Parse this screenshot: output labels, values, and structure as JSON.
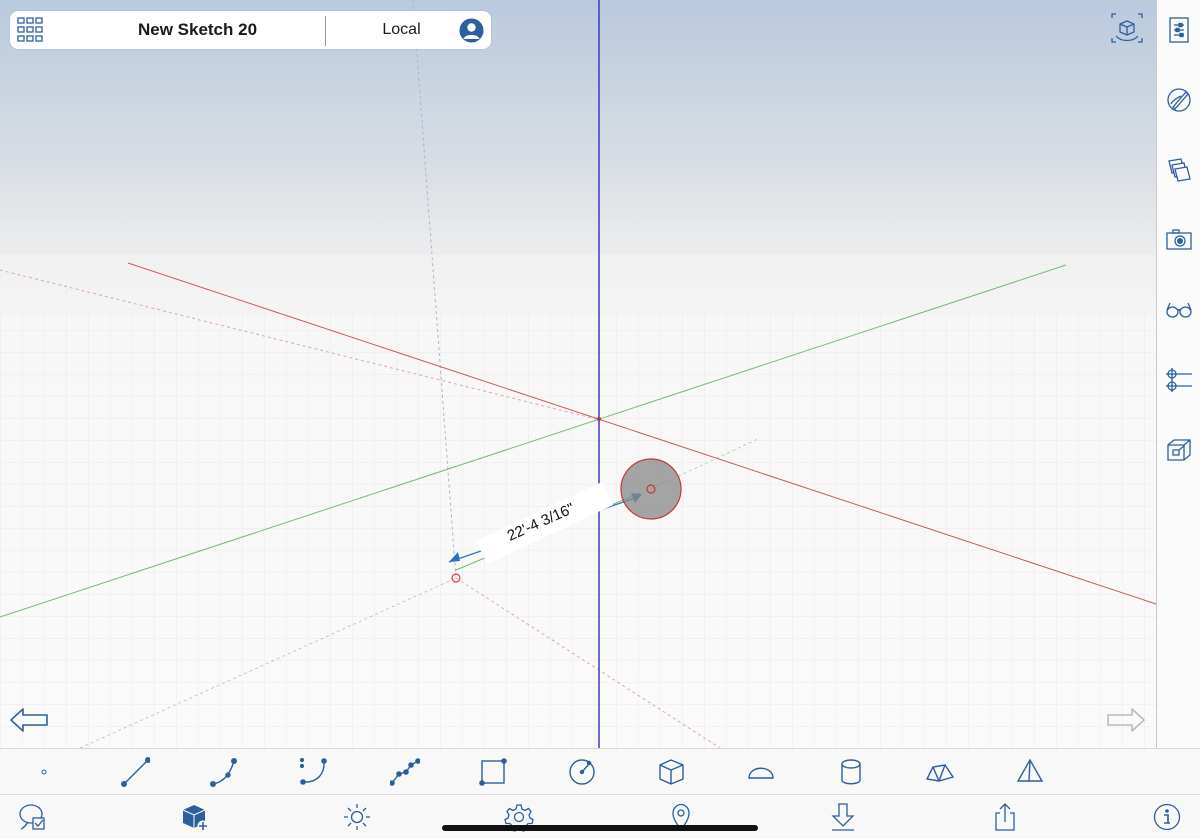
{
  "header": {
    "title": "New Sketch 20",
    "mode": "Local"
  },
  "viewport": {
    "dimension_label": "22'-4 3/16\""
  },
  "colors": {
    "accent": "#2b5f9e",
    "axis_red": "#cc5a5a",
    "axis_green": "#6cc06c",
    "axis_blue": "#3c3cbe",
    "sky_top": "#b9c9dd",
    "ground": "#fafafa"
  },
  "right_panel": {
    "icons": [
      "entity-info-icon",
      "materials-icon",
      "layers-icon",
      "scenes-camera-icon",
      "display-glasses-icon",
      "components-icon",
      "section-planes-icon"
    ]
  },
  "draw_toolbar": {
    "tools": [
      "point-tool",
      "line-tool",
      "arc-tool",
      "curve-tool",
      "polyline-tool",
      "rectangle-tool",
      "circle-tool",
      "box-tool",
      "dome-tool",
      "cylinder-tool",
      "prism-tool",
      "pyramid-tool"
    ]
  },
  "main_toolbar": {
    "tools": [
      "select-tool",
      "add-model-tool",
      "shadows-sun-tool",
      "settings-tool",
      "location-tool",
      "download-tool",
      "share-tool",
      "info-tool"
    ]
  }
}
